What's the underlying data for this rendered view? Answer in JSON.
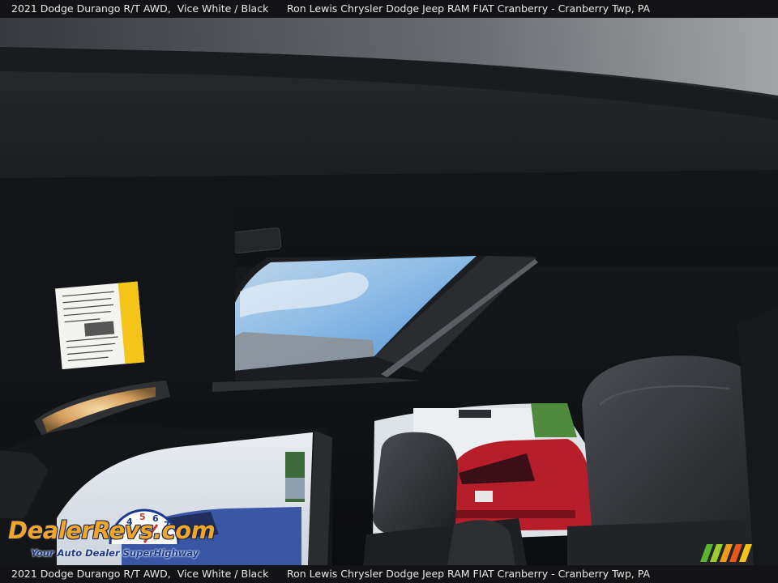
{
  "caption": {
    "vehicle": "2021 Dodge Durango R/T AWD,",
    "color": "Vice White / Black",
    "dealer": "Ron Lewis Chrysler Dodge Jeep RAM FIAT Cranberry - Cranberry Twp, PA"
  },
  "watermark": {
    "brand": "DealerRevs.com",
    "tagline": "Your Auto Dealer SuperHighway",
    "gauge_digits": [
      "4",
      "5",
      "6",
      "7"
    ]
  },
  "colors": {
    "headliner": "#121417",
    "sky": "#7fb4e3",
    "red_suv": "#b81e2a",
    "dome_light": "#e3b676",
    "warning_yellow": "#f4c418",
    "wm_orange": "#f2a629",
    "wm_blue": "#1b3a8c"
  },
  "icons": [
    "dealerrevs-speedometer-icon",
    "color-stripes-icon"
  ]
}
